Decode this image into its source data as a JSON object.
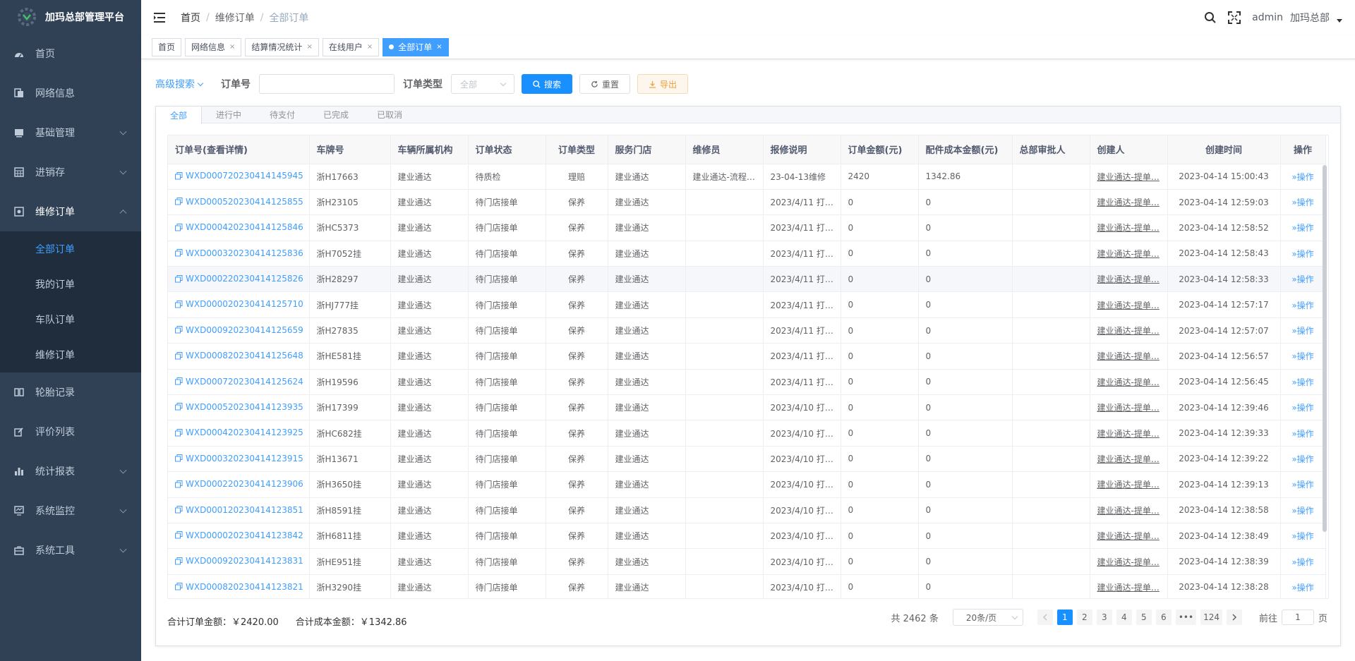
{
  "app": {
    "title": "加玛总部管理平台"
  },
  "sidebar": {
    "items": [
      {
        "label": "首页",
        "icon": "dashboard-icon",
        "has_children": false
      },
      {
        "label": "网络信息",
        "icon": "documents-icon",
        "has_children": false
      },
      {
        "label": "基础管理",
        "icon": "monitor-icon",
        "has_children": true
      },
      {
        "label": "进销存",
        "icon": "grid-icon",
        "has_children": true
      },
      {
        "label": "维修订单",
        "icon": "target-icon",
        "has_children": true,
        "expanded": true
      }
    ],
    "submenu": [
      {
        "label": "全部订单",
        "active": true
      },
      {
        "label": "我的订单",
        "active": false
      },
      {
        "label": "车队订单",
        "active": false
      },
      {
        "label": "维修订单",
        "active": false
      }
    ],
    "items_after": [
      {
        "label": "轮胎记录",
        "icon": "book-icon",
        "has_children": false
      },
      {
        "label": "评价列表",
        "icon": "edit-icon",
        "has_children": false
      },
      {
        "label": "统计报表",
        "icon": "bar-chart-icon",
        "has_children": true
      },
      {
        "label": "系统监控",
        "icon": "screen-icon",
        "has_children": true
      },
      {
        "label": "系统工具",
        "icon": "toolbox-icon",
        "has_children": true
      }
    ]
  },
  "header": {
    "breadcrumb": [
      "首页",
      "维修订单",
      "全部订单"
    ],
    "user": "admin",
    "org": "加玛总部"
  },
  "tags": [
    {
      "label": "首页",
      "closable": false,
      "active": false
    },
    {
      "label": "网络信息",
      "closable": true,
      "active": false
    },
    {
      "label": "结算情况统计",
      "closable": true,
      "active": false
    },
    {
      "label": "在线用户",
      "closable": true,
      "active": false
    },
    {
      "label": "全部订单",
      "closable": true,
      "active": true
    }
  ],
  "search": {
    "advanced_label": "高级搜索",
    "order_no_label": "订单号",
    "order_no_value": "",
    "order_type_label": "订单类型",
    "order_type_value": "全部",
    "search_btn": "搜索",
    "reset_btn": "重置",
    "export_btn": "导出"
  },
  "status_tabs": [
    "全部",
    "进行中",
    "待支付",
    "已完成",
    "已取消"
  ],
  "table": {
    "columns": [
      "订单号(查看详情)",
      "车牌号",
      "车辆所属机构",
      "订单状态",
      "订单类型",
      "服务门店",
      "维修员",
      "报修说明",
      "订单金额(元)",
      "配件成本金额(元)",
      "总部审批人",
      "创建人",
      "创建时间",
      "操作"
    ],
    "rows": [
      [
        "WXD000720230414145945",
        "浙H17663",
        "建业通达",
        "待质检",
        "理赔",
        "建业通达",
        "建业通达-流程…",
        "23-04-13维修",
        "2420",
        "1342.86",
        "",
        "建业通达-提单…",
        "2023-04-14 15:00:43",
        "操作"
      ],
      [
        "WXD000520230414125855",
        "浙H23105",
        "建业通达",
        "待门店接单",
        "保养",
        "建业通达",
        "",
        "2023/4/11 打…",
        "0",
        "0",
        "",
        "建业通达-提单…",
        "2023-04-14 12:59:03",
        "操作"
      ],
      [
        "WXD000420230414125846",
        "浙HC5373",
        "建业通达",
        "待门店接单",
        "保养",
        "建业通达",
        "",
        "2023/4/11 打…",
        "0",
        "0",
        "",
        "建业通达-提单…",
        "2023-04-14 12:58:52",
        "操作"
      ],
      [
        "WXD000320230414125836",
        "浙H7052挂",
        "建业通达",
        "待门店接单",
        "保养",
        "建业通达",
        "",
        "2023/4/11 打…",
        "0",
        "0",
        "",
        "建业通达-提单…",
        "2023-04-14 12:58:43",
        "操作"
      ],
      [
        "WXD000220230414125826",
        "浙H28297",
        "建业通达",
        "待门店接单",
        "保养",
        "建业通达",
        "",
        "2023/4/11 打…",
        "0",
        "0",
        "",
        "建业通达-提单…",
        "2023-04-14 12:58:33",
        "操作"
      ],
      [
        "WXD000020230414125710",
        "浙HJ777挂",
        "建业通达",
        "待门店接单",
        "保养",
        "建业通达",
        "",
        "2023/4/11 打…",
        "0",
        "0",
        "",
        "建业通达-提单…",
        "2023-04-14 12:57:17",
        "操作"
      ],
      [
        "WXD000920230414125659",
        "浙H27835",
        "建业通达",
        "待门店接单",
        "保养",
        "建业通达",
        "",
        "2023/4/11 打…",
        "0",
        "0",
        "",
        "建业通达-提单…",
        "2023-04-14 12:57:07",
        "操作"
      ],
      [
        "WXD000820230414125648",
        "浙HE581挂",
        "建业通达",
        "待门店接单",
        "保养",
        "建业通达",
        "",
        "2023/4/11 打…",
        "0",
        "0",
        "",
        "建业通达-提单…",
        "2023-04-14 12:56:57",
        "操作"
      ],
      [
        "WXD000720230414125624",
        "浙H19596",
        "建业通达",
        "待门店接单",
        "保养",
        "建业通达",
        "",
        "2023/4/11 打…",
        "0",
        "0",
        "",
        "建业通达-提单…",
        "2023-04-14 12:56:45",
        "操作"
      ],
      [
        "WXD000520230414123935",
        "浙H17399",
        "建业通达",
        "待门店接单",
        "保养",
        "建业通达",
        "",
        "2023/4/10 打…",
        "0",
        "0",
        "",
        "建业通达-提单…",
        "2023-04-14 12:39:46",
        "操作"
      ],
      [
        "WXD000420230414123925",
        "浙HC682挂",
        "建业通达",
        "待门店接单",
        "保养",
        "建业通达",
        "",
        "2023/4/10 打…",
        "0",
        "0",
        "",
        "建业通达-提单…",
        "2023-04-14 12:39:33",
        "操作"
      ],
      [
        "WXD000320230414123915",
        "浙H13671",
        "建业通达",
        "待门店接单",
        "保养",
        "建业通达",
        "",
        "2023/4/10 打…",
        "0",
        "0",
        "",
        "建业通达-提单…",
        "2023-04-14 12:39:22",
        "操作"
      ],
      [
        "WXD000220230414123906",
        "浙H3650挂",
        "建业通达",
        "待门店接单",
        "保养",
        "建业通达",
        "",
        "2023/4/10 打…",
        "0",
        "0",
        "",
        "建业通达-提单…",
        "2023-04-14 12:39:13",
        "操作"
      ],
      [
        "WXD000120230414123851",
        "浙H8591挂",
        "建业通达",
        "待门店接单",
        "保养",
        "建业通达",
        "",
        "2023/4/10 打…",
        "0",
        "0",
        "",
        "建业通达-提单…",
        "2023-04-14 12:38:58",
        "操作"
      ],
      [
        "WXD000020230414123842",
        "浙H6811挂",
        "建业通达",
        "待门店接单",
        "保养",
        "建业通达",
        "",
        "2023/4/10 打…",
        "0",
        "0",
        "",
        "建业通达-提单…",
        "2023-04-14 12:38:49",
        "操作"
      ],
      [
        "WXD000920230414123831",
        "浙HE951挂",
        "建业通达",
        "待门店接单",
        "保养",
        "建业通达",
        "",
        "2023/4/10 打…",
        "0",
        "0",
        "",
        "建业通达-提单…",
        "2023-04-14 12:38:39",
        "操作"
      ],
      [
        "WXD000820230414123821",
        "浙H3290挂",
        "建业通达",
        "待门店接单",
        "保养",
        "建业通达",
        "",
        "2023/4/10 打…",
        "0",
        "0",
        "",
        "建业通达-提单…",
        "2023-04-14 12:38:28",
        "操作"
      ]
    ]
  },
  "footer": {
    "order_total_label": "合计订单金额：",
    "order_total_value": "￥2420.00",
    "cost_total_label": "合计成本金额：",
    "cost_total_value": "￥1342.86"
  },
  "pagination": {
    "total_text": "共 2462 条",
    "page_size": "20条/页",
    "pages": [
      "1",
      "2",
      "3",
      "4",
      "5",
      "6",
      "•••",
      "124"
    ],
    "current": "1",
    "goto_label": "前往",
    "goto_value": "1",
    "page_suffix": "页"
  },
  "colors": {
    "sidebar_bg": "#304156",
    "primary": "#1890ff",
    "link": "#409eff"
  }
}
